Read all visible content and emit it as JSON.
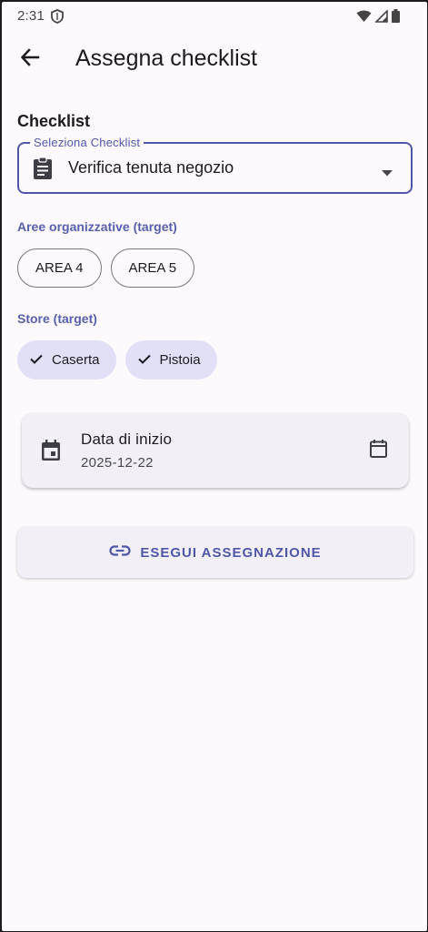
{
  "status_bar": {
    "time": "2:31",
    "icons": [
      "shield-icon",
      "wifi-icon",
      "signal-icon",
      "battery-icon"
    ]
  },
  "app_bar": {
    "back_icon": "arrow-back-icon",
    "title": "Assegna checklist"
  },
  "checklist_section": {
    "heading": "Checklist",
    "dropdown": {
      "label": "Seleziona Checklist",
      "value": "Verifica tenuta negozio",
      "leading_icon": "clipboard-icon",
      "trailing_icon": "dropdown-arrow-icon"
    }
  },
  "areas": {
    "label": "Aree organizzative (target)",
    "chips": [
      {
        "label": "AREA 4",
        "selected": false
      },
      {
        "label": "AREA 5",
        "selected": false
      }
    ]
  },
  "stores": {
    "label": "Store (target)",
    "chips": [
      {
        "label": "Caserta",
        "selected": true
      },
      {
        "label": "Pistoia",
        "selected": true
      }
    ]
  },
  "start_date": {
    "title": "Data di inizio",
    "value": "2025-12-22",
    "leading_icon": "calendar-filled-icon",
    "trailing_icon": "calendar-outline-icon"
  },
  "assign_button": {
    "label": "ESEGUI ASSEGNAZIONE",
    "icon": "link-icon"
  },
  "colors": {
    "accent": "#4f57a8",
    "background": "#fdf9fd",
    "selected_chip": "#e1e0f7",
    "card": "#f3eff6"
  }
}
